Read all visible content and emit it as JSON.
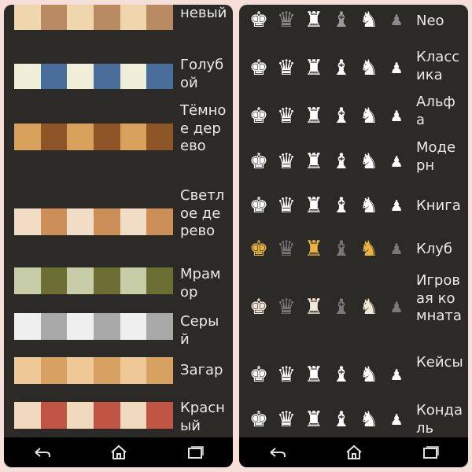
{
  "boards": [
    {
      "label": "Коричневый",
      "colors": [
        "#f0d6ad",
        "#b88b62"
      ]
    },
    {
      "label": "Голубой",
      "colors": [
        "#efefd9",
        "#4a6e9c"
      ]
    },
    {
      "label": "Тёмное дерево",
      "colors": [
        "#d8a25c",
        "#8e5627"
      ]
    },
    {
      "label": "Светлое дерево",
      "colors": [
        "#f1dcc5",
        "#cc8f58"
      ]
    },
    {
      "label": "Мрамор",
      "colors": [
        "#c7cda6",
        "#6c6e33"
      ]
    },
    {
      "label": "Серый",
      "colors": [
        "#efefef",
        "#a9a9a9"
      ]
    },
    {
      "label": "Загар",
      "colors": [
        "#efc898",
        "#d7a261"
      ]
    },
    {
      "label": "Красный",
      "colors": [
        "#f1d9bd",
        "#c05543"
      ]
    }
  ],
  "piece_sets": [
    {
      "label": "Neo",
      "colors": [
        "#ffffff",
        "#8a8a8a",
        "#ffffff",
        "#9a9a9a",
        "#ffffff",
        "#8a8a8a"
      ]
    },
    {
      "label": "Классика",
      "colors": [
        "#ffffff",
        "#ffffff",
        "#ffffff",
        "#ffffff",
        "#ffffff",
        "#ffffff"
      ]
    },
    {
      "label": "Альфа",
      "colors": [
        "#ffffff",
        "#ffffff",
        "#ffffff",
        "#ffffff",
        "#ffffff",
        "#ffffff"
      ]
    },
    {
      "label": "Модерн",
      "colors": [
        "#ffffff",
        "#ffffff",
        "#ffffff",
        "#ffffff",
        "#ffffff",
        "#ffffff"
      ]
    },
    {
      "label": "Книга",
      "colors": [
        "#ffffff",
        "#ffffff",
        "#ffffff",
        "#ffffff",
        "#ffffff",
        "#ffffff"
      ]
    },
    {
      "label": "Клуб",
      "colors": [
        "#e8b341",
        "#777777",
        "#e8b341",
        "#777777",
        "#e8b341",
        "#777777"
      ]
    },
    {
      "label": "Игровая комната",
      "colors": [
        "#f3e7d8",
        "#7a7a7a",
        "#f3e7d8",
        "#7a7a7a",
        "#f3e7d8",
        "#7a7a7a"
      ]
    },
    {
      "label": "Кейсы",
      "colors": [
        "#ffffff",
        "#ffffff",
        "#ffffff",
        "#ffffff",
        "#ffffff",
        "#ffffff"
      ]
    },
    {
      "label": "Кондаль",
      "colors": [
        "#ffffff",
        "#ffffff",
        "#ffffff",
        "#ffffff",
        "#ffffff",
        "#ffffff"
      ]
    }
  ],
  "pieces": [
    "♚",
    "♛",
    "♜",
    "♝",
    "♞",
    "♟"
  ],
  "nav": {
    "back": "back-icon",
    "home": "home-icon",
    "recents": "recents-icon"
  }
}
